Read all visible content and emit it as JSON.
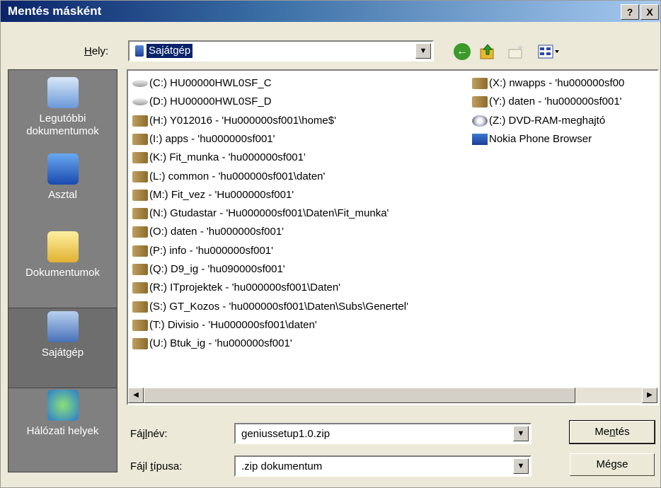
{
  "window": {
    "title": "Mentés másként",
    "help": "?",
    "close": "X"
  },
  "toolbar": {
    "look_in_label": "Hely:",
    "look_in_value": "Sajátgép"
  },
  "places": [
    {
      "line1": "Legutóbbi",
      "line2": "dokumentumok",
      "icon": "recent-documents-icon"
    },
    {
      "line1": "Asztal",
      "line2": "",
      "icon": "desktop-icon"
    },
    {
      "line1": "Dokumentumok",
      "line2": "",
      "icon": "documents-icon"
    },
    {
      "line1": "Sajátgép",
      "line2": "",
      "icon": "my-computer-icon"
    },
    {
      "line1": "Hálózati helyek",
      "line2": "",
      "icon": "network-places-icon"
    }
  ],
  "files": [
    {
      "label": "(C:) HU00000HWL0SF_C",
      "icon": "hdd"
    },
    {
      "label": "(D:) HU00000HWL0SF_D",
      "icon": "hdd"
    },
    {
      "label": "(H:) Y012016 - 'Hu000000sf001\\home$'",
      "icon": "net"
    },
    {
      "label": "(I:) apps - 'hu000000sf001'",
      "icon": "net"
    },
    {
      "label": "(K:) Fit_munka - 'hu000000sf001'",
      "icon": "net"
    },
    {
      "label": "(L:) common - 'hu000000sf001\\daten'",
      "icon": "net"
    },
    {
      "label": "(M:) Fit_vez - 'Hu000000sf001'",
      "icon": "net"
    },
    {
      "label": "(N:) Gtudastar - 'Hu000000sf001\\Daten\\Fit_munka'",
      "icon": "net"
    },
    {
      "label": "(O:) daten - 'hu000000sf001'",
      "icon": "net"
    },
    {
      "label": "(P:) info - 'hu000000sf001'",
      "icon": "net"
    },
    {
      "label": "(Q:) D9_ig - 'hu090000sf001'",
      "icon": "net"
    },
    {
      "label": "(R:) ITprojektek - 'hu000000sf001\\Daten'",
      "icon": "net"
    },
    {
      "label": "(S:) GT_Kozos - 'hu000000sf001\\Daten\\Subs\\Genertel'",
      "icon": "net"
    },
    {
      "label": "(T:) Divisio - 'Hu000000sf001\\daten'",
      "icon": "net"
    },
    {
      "label": "(U:) Btuk_ig - 'hu000000sf001'",
      "icon": "net"
    },
    {
      "label": "(X:) nwapps - 'hu000000sf00",
      "icon": "net"
    },
    {
      "label": "(Y:) daten - 'hu000000sf001'",
      "icon": "net"
    },
    {
      "label": "(Z:) DVD-RAM-meghajtó",
      "icon": "dvd"
    },
    {
      "label": "Nokia Phone Browser",
      "icon": "phone"
    }
  ],
  "filename": {
    "label_pre": "Fáj",
    "label_key": "l",
    "label_post": "név:",
    "value": "geniussetup1.0.zip"
  },
  "filetype": {
    "label_pre": "Fájl ",
    "label_key": "t",
    "label_post": "ípusa:",
    "value": ".zip dokumentum"
  },
  "buttons": {
    "save_pre": "Me",
    "save_key": "n",
    "save_post": "tés",
    "cancel": "Mégse"
  }
}
